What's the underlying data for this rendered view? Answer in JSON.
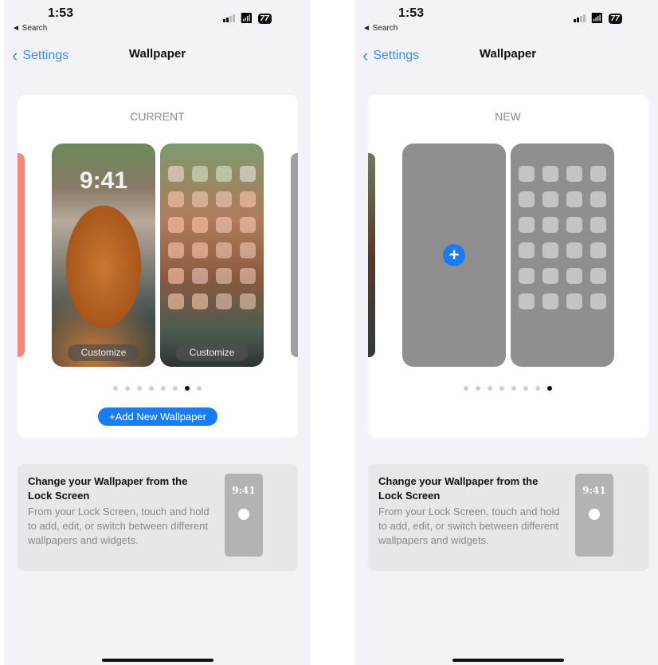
{
  "status": {
    "time": "1:53",
    "back_app": "◄ Search",
    "battery": "77"
  },
  "nav": {
    "back_label": "Settings",
    "title": "Wallpaper"
  },
  "left": {
    "label": "CURRENT",
    "lock_time": "9:41",
    "customize": "Customize",
    "dots_total": 8,
    "active_dot": 7,
    "add_button": "+Add New Wallpaper"
  },
  "right": {
    "label": "NEW",
    "dots_total": 8,
    "active_dot": 8
  },
  "info": {
    "title": "Change your Wallpaper from the Lock Screen",
    "body": "From your Lock Screen, touch and hold to add, edit, or switch between different wallpapers and widgets.",
    "mini_time": "9:41"
  },
  "colors": {
    "accent": "#1a7cf5",
    "background": "#f2f2f7"
  }
}
